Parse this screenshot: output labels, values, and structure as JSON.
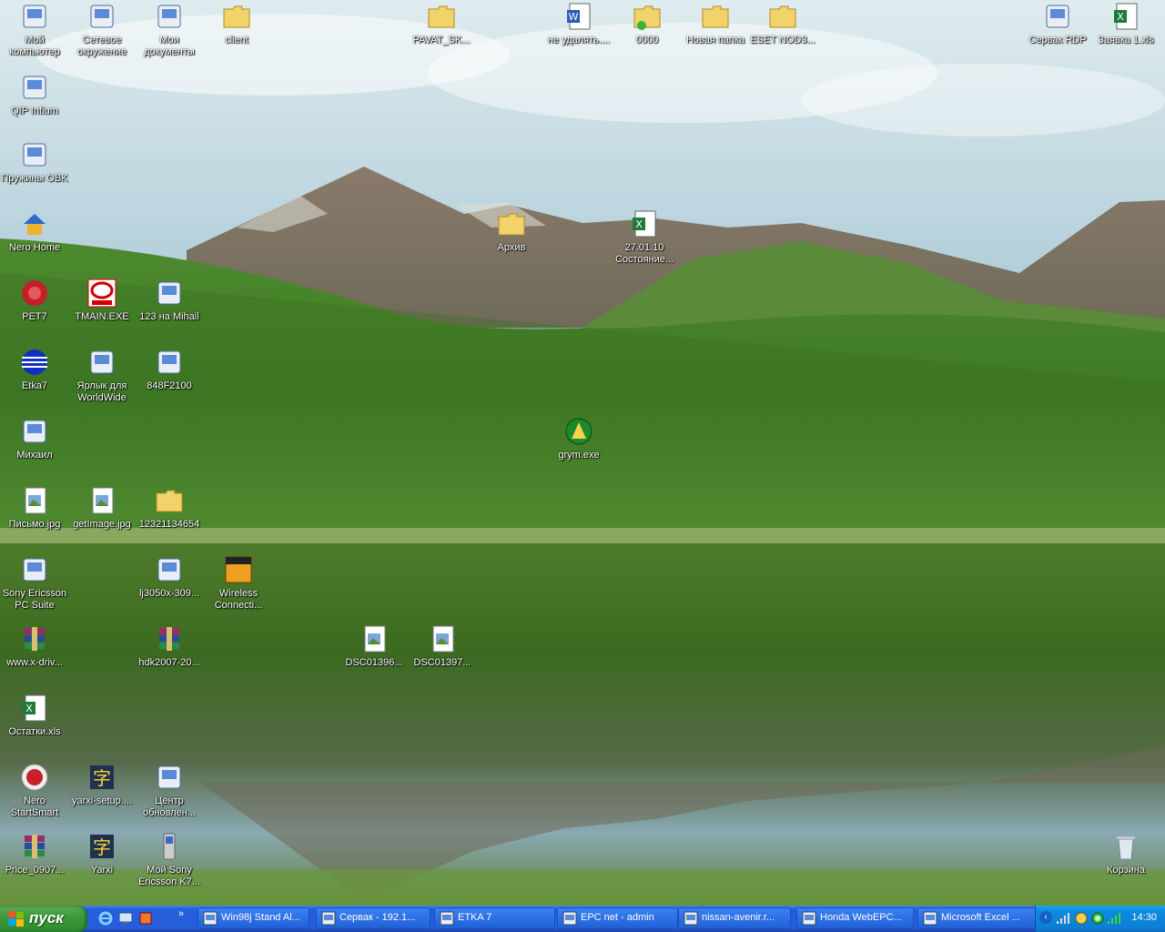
{
  "desktop_icons": [
    {
      "label": "Мой компьютер",
      "icon": "my-computer-icon"
    },
    {
      "label": "Сетевое окружение",
      "icon": "network-places-icon"
    },
    {
      "label": "Мои документы",
      "icon": "my-documents-icon"
    },
    {
      "label": "client",
      "icon": "folder-icon"
    },
    {
      "label": "PAVAT_SK...",
      "icon": "folder-icon"
    },
    {
      "label": "не удалять....",
      "icon": "word-document-icon"
    },
    {
      "label": "0000",
      "icon": "shared-folder-icon"
    },
    {
      "label": "Новая папка",
      "icon": "folder-icon"
    },
    {
      "label": "ESET NOD3...",
      "icon": "folder-icon"
    },
    {
      "label": "Сервак RDP",
      "icon": "remote-desktop-icon"
    },
    {
      "label": "Заявка 1.xls",
      "icon": "excel-file-icon"
    },
    {
      "label": "QIP Infium",
      "icon": "qip-icon"
    },
    {
      "label": "Пружины OBK",
      "icon": "spring-app-icon"
    },
    {
      "label": "Nero Home",
      "icon": "nero-home-icon"
    },
    {
      "label": "Архив",
      "icon": "folder-icon"
    },
    {
      "label": "27.01.10 Состояние...",
      "icon": "excel-file-icon"
    },
    {
      "label": "PET7",
      "icon": "pet7-icon"
    },
    {
      "label": "TMAIN.EXE",
      "icon": "toyota-icon"
    },
    {
      "label": "123 на Mihail",
      "icon": "network-shortcut-icon"
    },
    {
      "label": "Etka7",
      "icon": "etka-icon"
    },
    {
      "label": "Ярлык для WorldWide",
      "icon": "worldwide-icon"
    },
    {
      "label": "848F2100",
      "icon": "windows-file-icon"
    },
    {
      "label": "Михаил",
      "icon": "network-computer-icon"
    },
    {
      "label": "grym.exe",
      "icon": "grym-icon"
    },
    {
      "label": "Письмо.jpg",
      "icon": "image-file-icon"
    },
    {
      "label": "getImage.jpg",
      "icon": "image-file-icon"
    },
    {
      "label": "12321134654",
      "icon": "folder-icon"
    },
    {
      "label": "Sony Ericsson PC Suite",
      "icon": "sony-ericsson-icon"
    },
    {
      "label": "lj3050x-309...",
      "icon": "installer-icon"
    },
    {
      "label": "Wireless Connecti...",
      "icon": "dlink-icon"
    },
    {
      "label": "www.x-driv...",
      "icon": "winrar-icon"
    },
    {
      "label": "hdk2007-20...",
      "icon": "winrar-icon"
    },
    {
      "label": "DSC01396...",
      "icon": "image-file-icon"
    },
    {
      "label": "DSC01397...",
      "icon": "image-file-icon"
    },
    {
      "label": "Остатки.xls",
      "icon": "excel-file-icon"
    },
    {
      "label": "Nero StartSmart",
      "icon": "nero-icon"
    },
    {
      "label": "yarxi-setup....",
      "icon": "yarxi-icon"
    },
    {
      "label": "Центр обновлен...",
      "icon": "update-center-icon"
    },
    {
      "label": "Price_0907...",
      "icon": "winrar-icon"
    },
    {
      "label": "Yarxi",
      "icon": "yarxi-icon"
    },
    {
      "label": "Мой Sony Ericsson K7...",
      "icon": "phone-icon"
    },
    {
      "label": "Корзина",
      "icon": "recycle-bin-icon"
    }
  ],
  "taskbar": {
    "start_label": "пуск",
    "quick_launch": [
      {
        "icon": "ie-icon"
      },
      {
        "icon": "show-desktop-icon"
      },
      {
        "icon": "app-icon"
      },
      {
        "icon": "chevron-icon"
      }
    ],
    "tasks": [
      {
        "label": "Win98j Stand Al...",
        "icon": "window-icon"
      },
      {
        "label": "Сервак - 192.1...",
        "icon": "remote-desktop-icon"
      },
      {
        "label": "ETKA 7",
        "icon": "etka-icon"
      },
      {
        "label": "EPC net - admin",
        "icon": "epc-icon"
      },
      {
        "label": "nissan-avenir.r...",
        "icon": "ie-icon"
      },
      {
        "label": "Honda WebEPC...",
        "icon": "ie-icon"
      },
      {
        "label": "Microsoft Excel ...",
        "icon": "excel-icon"
      }
    ],
    "tray": {
      "time": "14:30",
      "icons": [
        "back-arrow-icon",
        "network-signal-icon",
        "clock-sync-icon",
        "network-icon",
        "status-icon",
        "signal-icon"
      ]
    }
  }
}
